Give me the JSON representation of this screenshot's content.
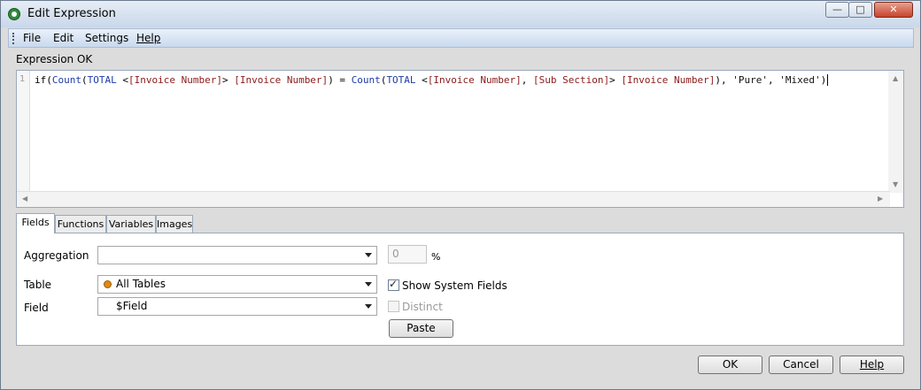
{
  "window": {
    "title": "Edit Expression",
    "min_glyph": "—",
    "max_glyph": "□",
    "close_glyph": "✕"
  },
  "menu": {
    "file": "File",
    "edit": "Edit",
    "settings": "Settings",
    "help": "Help"
  },
  "status": "Expression OK",
  "editor": {
    "line_number": "1",
    "tokens": {
      "t1": "if(",
      "t2": "Count",
      "t3": "(",
      "t4": "TOTAL",
      "t5": " <",
      "t6": "[Invoice Number]",
      "t7": "> ",
      "t8": "[Invoice Number]",
      "t9": ") = ",
      "t10": "Count",
      "t11": "(",
      "t12": "TOTAL",
      "t13": " <",
      "t14": "[Invoice Number]",
      "t15": ", ",
      "t16": "[Sub Section]",
      "t17": "> ",
      "t18": "[Invoice Number]",
      "t19": "), ",
      "t20": "'Pure'",
      "t21": ", ",
      "t22": "'Mixed'",
      "t23": ")"
    }
  },
  "tabs": {
    "fields": "Fields",
    "functions": "Functions",
    "variables": "Variables",
    "images": "Images"
  },
  "panel": {
    "aggregation_label": "Aggregation",
    "aggregation_value": "",
    "percent_value": "0",
    "percent_sign": "%",
    "table_label": "Table",
    "table_value": "All Tables",
    "field_label": "Field",
    "field_value": "$Field",
    "show_system_fields": "Show System Fields",
    "show_system_fields_checked": true,
    "distinct": "Distinct",
    "distinct_checked": false,
    "paste": "Paste"
  },
  "buttons": {
    "ok": "OK",
    "cancel": "Cancel",
    "help": "Help"
  }
}
